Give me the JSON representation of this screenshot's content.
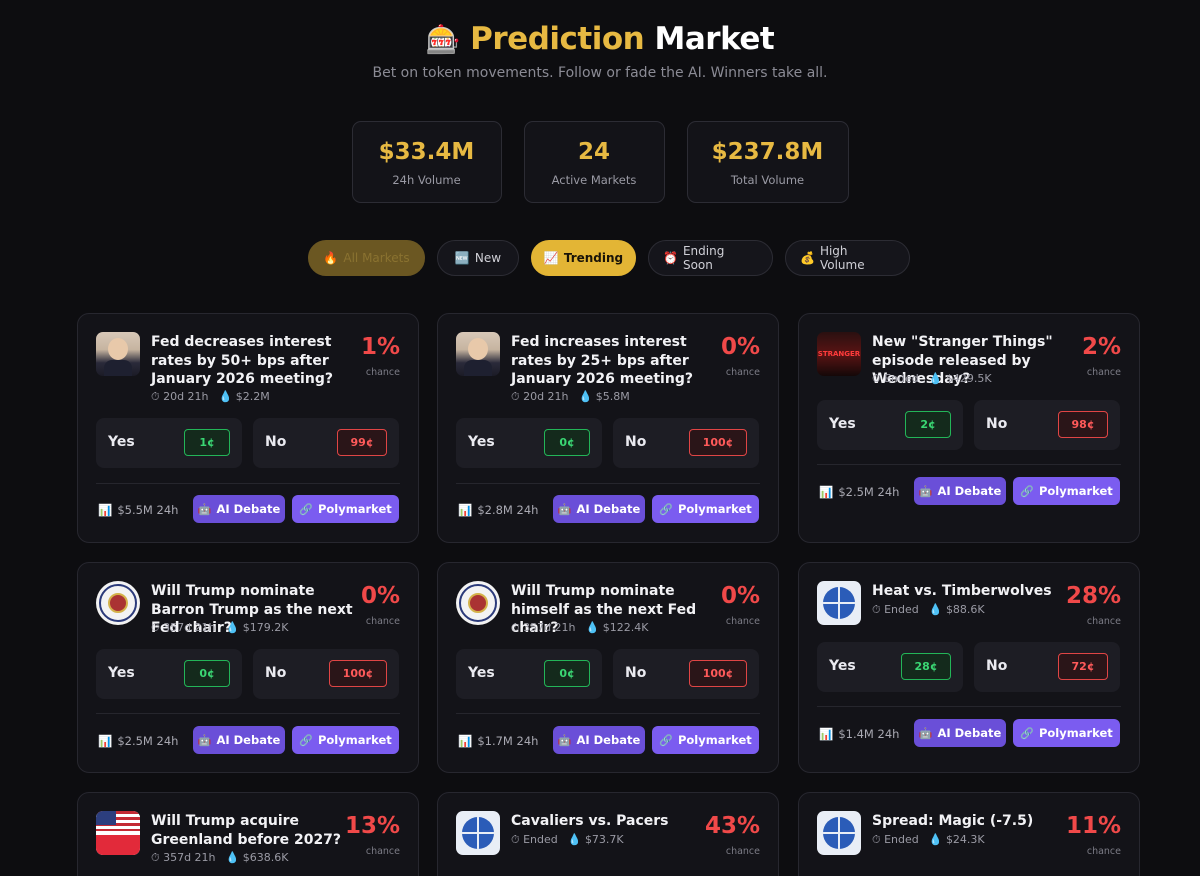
{
  "header": {
    "icon": "slot-machine-icon",
    "title_gold": "Prediction",
    "title_white": "Market",
    "subtitle": "Bet on token movements. Follow or fade the AI. Winners take all."
  },
  "stats": [
    {
      "value": "$33.4M",
      "label": "24h Volume"
    },
    {
      "value": "24",
      "label": "Active Markets"
    },
    {
      "value": "$237.8M",
      "label": "Total Volume"
    }
  ],
  "filters": [
    {
      "icon": "🔥",
      "label": "All Markets"
    },
    {
      "icon": "🆕",
      "label": "New"
    },
    {
      "icon": "📈",
      "label": "Trending"
    },
    {
      "icon": "⏰",
      "label": "Ending Soon"
    },
    {
      "icon": "💰",
      "label": "High Volume"
    }
  ],
  "cards": [
    {
      "question": "Fed decreases interest rates by 50+ bps after January 2026 meeting?",
      "time": "20d 21h",
      "liquidity": "$2.2M",
      "percent": "1%",
      "chance_label": "chance",
      "yes_label": "Yes",
      "yes_price": "1¢",
      "no_label": "No",
      "no_price": "99¢",
      "volume": "$5.5M 24h",
      "ai_label": "AI Debate",
      "poly_label": "Polymarket"
    },
    {
      "question": "Fed increases interest rates by 25+ bps after January 2026 meeting?",
      "time": "20d 21h",
      "liquidity": "$5.8M",
      "percent": "0%",
      "chance_label": "chance",
      "yes_label": "Yes",
      "yes_price": "0¢",
      "no_label": "No",
      "no_price": "100¢",
      "volume": "$2.8M 24h",
      "ai_label": "AI Debate",
      "poly_label": "Polymarket"
    },
    {
      "question": "New \"Stranger Things\" episode released by Wednesday?",
      "time": "Ended",
      "liquidity": "$429.5K",
      "percent": "2%",
      "chance_label": "chance",
      "yes_label": "Yes",
      "yes_price": "2¢",
      "no_label": "No",
      "no_price": "98¢",
      "volume": "$2.5M 24h",
      "ai_label": "AI Debate",
      "poly_label": "Polymarket"
    },
    {
      "question": "Will Trump nominate Barron Trump as the next Fed chair?",
      "time": "357d 21h",
      "liquidity": "$179.2K",
      "percent": "0%",
      "chance_label": "chance",
      "yes_label": "Yes",
      "yes_price": "0¢",
      "no_label": "No",
      "no_price": "100¢",
      "volume": "$2.5M 24h",
      "ai_label": "AI Debate",
      "poly_label": "Polymarket"
    },
    {
      "question": "Will Trump nominate himself as the next Fed chair?",
      "time": "357d 21h",
      "liquidity": "$122.4K",
      "percent": "0%",
      "chance_label": "chance",
      "yes_label": "Yes",
      "yes_price": "0¢",
      "no_label": "No",
      "no_price": "100¢",
      "volume": "$1.7M 24h",
      "ai_label": "AI Debate",
      "poly_label": "Polymarket"
    },
    {
      "question": "Heat vs. Timberwolves",
      "time": "Ended",
      "liquidity": "$88.6K",
      "percent": "28%",
      "chance_label": "chance",
      "yes_label": "Yes",
      "yes_price": "28¢",
      "no_label": "No",
      "no_price": "72¢",
      "volume": "$1.4M 24h",
      "ai_label": "AI Debate",
      "poly_label": "Polymarket"
    },
    {
      "question": "Will Trump acquire Greenland before 2027?",
      "time": "357d 21h",
      "liquidity": "$638.6K",
      "percent": "13%",
      "chance_label": "chance"
    },
    {
      "question": "Cavaliers vs. Pacers",
      "time": "Ended",
      "liquidity": "$73.7K",
      "percent": "43%",
      "chance_label": "chance"
    },
    {
      "question": "Spread: Magic (-7.5)",
      "time": "Ended",
      "liquidity": "$24.3K",
      "percent": "11%",
      "chance_label": "chance"
    }
  ],
  "colors": {
    "gold": "#e7b942",
    "yes": "#3ad673",
    "no": "#ff5a5a",
    "button": "#7b5cf0",
    "background": "#0d0d10"
  }
}
